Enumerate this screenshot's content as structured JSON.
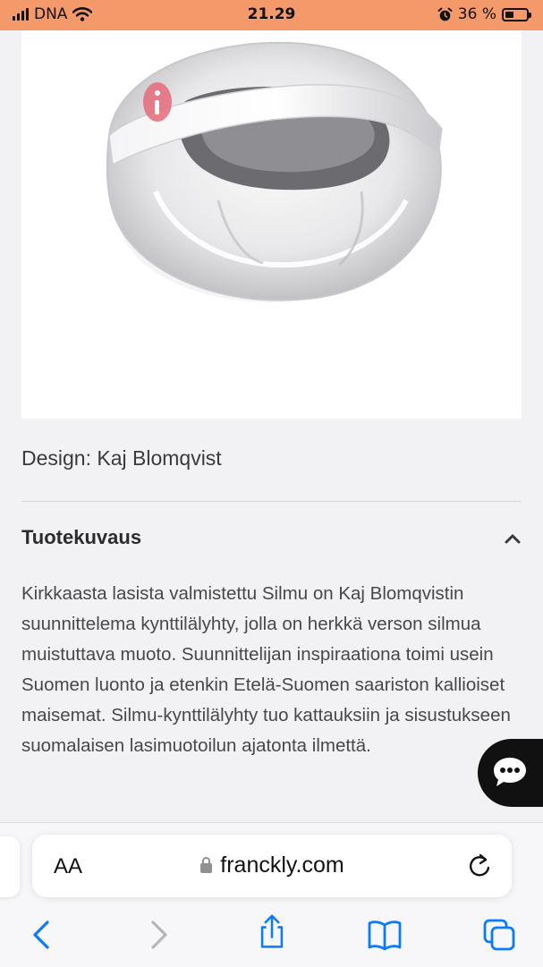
{
  "status_bar": {
    "carrier": "DNA",
    "time": "21.29",
    "battery_percent": "36 %",
    "battery_level": 0.36
  },
  "product": {
    "image_icon": "glass-candle-holder-image",
    "designer_line": "Design: Kaj Blomqvist"
  },
  "description_section": {
    "title": "Tuotekuvaus",
    "expanded": true,
    "body": "Kirkkaasta lasista valmistettu Silmu on Kaj Blomqvistin suunnittelema kynttilälyhty, jolla on herkkä verson silmua muistuttava muoto. Suunnittelijan inspiraationa toimi usein Suomen luonto ja etenkin Etelä-Suomen saariston kallioiset maisemat. Silmu-kynttilälyhty tuo kattauksiin ja sisustukseen suomalaisen lasimuotoilun ajatonta ilmettä."
  },
  "browser": {
    "aa_label": "AA",
    "url": "franckly.com"
  },
  "colors": {
    "status_bar_bg": "#f4996a",
    "accent_blue": "#0a7aff",
    "chat_button_bg": "#111111"
  }
}
